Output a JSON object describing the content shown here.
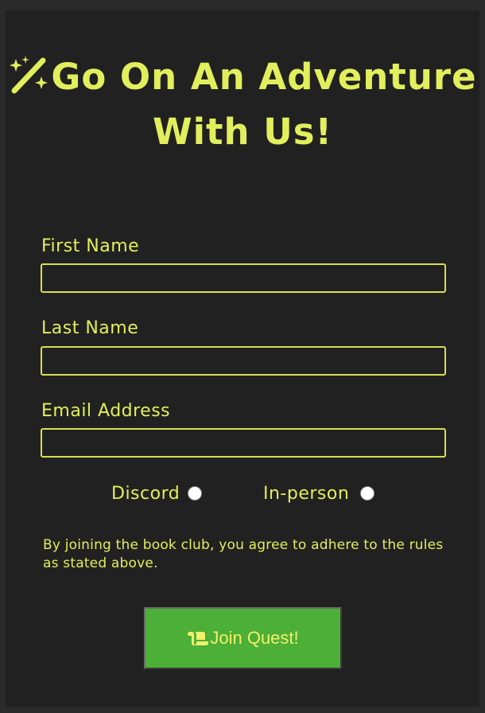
{
  "form": {
    "title": "Go On An Adventure With Us!",
    "title_icon": "magic-wand-sparkles-icon",
    "fields": [
      {
        "label": "First Name",
        "value": "",
        "placeholder": ""
      },
      {
        "label": "Last Name",
        "value": "",
        "placeholder": ""
      },
      {
        "label": "Email Address",
        "value": "",
        "placeholder": ""
      }
    ],
    "meeting_options": [
      {
        "label": "Discord",
        "selected": false
      },
      {
        "label": "In-person",
        "selected": false
      }
    ],
    "agreement_text": "By joining the book club, you agree to adhere to the rules as stated above.",
    "submit": {
      "label": "Join Quest!",
      "icon": "scroll-icon"
    }
  },
  "colors": {
    "page_background": "#2b2b2b",
    "panel_background": "#222121",
    "accent_text": "#e1ef5c",
    "button_background": "#4caf37"
  }
}
